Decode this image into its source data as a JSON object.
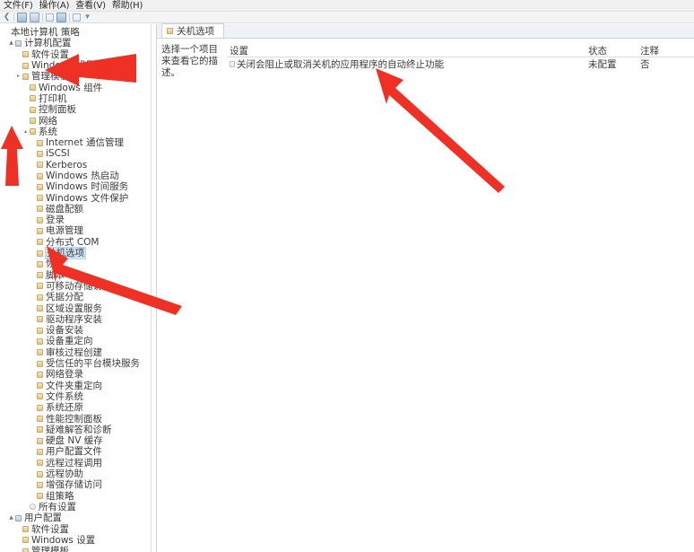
{
  "window": {
    "menu": [
      {
        "label": "文件(F)",
        "name": "menu-file"
      },
      {
        "label": "操作(A)",
        "name": "menu-action"
      },
      {
        "label": "查看(V)",
        "name": "menu-view"
      },
      {
        "label": "帮助(H)",
        "name": "menu-help"
      }
    ],
    "toolbar_icons": [
      "back-arrow-icon",
      "separator",
      "properties-icon",
      "folder-icon",
      "separator",
      "refresh-icon",
      "export-icon",
      "separator",
      "help-icon",
      "filter-icon"
    ]
  },
  "tree": {
    "root": "本地计算机 策略",
    "nodes": [
      {
        "label": "本地计算机 策略",
        "level": 0,
        "expander": "",
        "icon": "root",
        "selected": false
      },
      {
        "label": "计算机配置",
        "level": 1,
        "expander": "▲",
        "icon": "pc",
        "selected": false
      },
      {
        "label": "软件设置",
        "level": 2,
        "expander": "",
        "icon": "folder",
        "selected": false
      },
      {
        "label": "Windows 设置",
        "level": 2,
        "expander": "",
        "icon": "folder",
        "selected": false
      },
      {
        "label": "管理模板",
        "level": 2,
        "expander": "▸",
        "icon": "folder",
        "selected": false
      },
      {
        "label": "Windows 组件",
        "level": 3,
        "expander": "",
        "icon": "folder",
        "selected": false
      },
      {
        "label": "打印机",
        "level": 3,
        "expander": "",
        "icon": "folder",
        "selected": false
      },
      {
        "label": "控制面板",
        "level": 3,
        "expander": "",
        "icon": "folder",
        "selected": false
      },
      {
        "label": "网络",
        "level": 3,
        "expander": "",
        "icon": "folder",
        "selected": false
      },
      {
        "label": "系统",
        "level": 3,
        "expander": "▴",
        "icon": "folder",
        "selected": false
      },
      {
        "label": "Internet 通信管理",
        "level": 4,
        "expander": "",
        "icon": "folder",
        "selected": false
      },
      {
        "label": "iSCSI",
        "level": 4,
        "expander": "",
        "icon": "folder",
        "selected": false
      },
      {
        "label": "Kerberos",
        "level": 4,
        "expander": "",
        "icon": "folder",
        "selected": false
      },
      {
        "label": "Windows 热启动",
        "level": 4,
        "expander": "",
        "icon": "folder",
        "selected": false
      },
      {
        "label": "Windows 时间服务",
        "level": 4,
        "expander": "",
        "icon": "folder",
        "selected": false
      },
      {
        "label": "Windows 文件保护",
        "level": 4,
        "expander": "",
        "icon": "folder",
        "selected": false
      },
      {
        "label": "磁盘配额",
        "level": 4,
        "expander": "",
        "icon": "folder",
        "selected": false
      },
      {
        "label": "登录",
        "level": 4,
        "expander": "",
        "icon": "folder",
        "selected": false
      },
      {
        "label": "电源管理",
        "level": 4,
        "expander": "",
        "icon": "folder",
        "selected": false
      },
      {
        "label": "分布式 COM",
        "level": 4,
        "expander": "",
        "icon": "folder",
        "selected": false
      },
      {
        "label": "关机选项",
        "level": 4,
        "expander": "",
        "icon": "folder",
        "selected": true
      },
      {
        "label": "恢复",
        "level": 4,
        "expander": "",
        "icon": "folder",
        "selected": false
      },
      {
        "label": "脚本",
        "level": 4,
        "expander": "",
        "icon": "folder",
        "selected": false
      },
      {
        "label": "可移动存储访问",
        "level": 4,
        "expander": "",
        "icon": "folder",
        "selected": false
      },
      {
        "label": "凭据分配",
        "level": 4,
        "expander": "",
        "icon": "folder",
        "selected": false
      },
      {
        "label": "区域设置服务",
        "level": 4,
        "expander": "",
        "icon": "folder",
        "selected": false
      },
      {
        "label": "驱动程序安装",
        "level": 4,
        "expander": "",
        "icon": "folder",
        "selected": false
      },
      {
        "label": "设备安装",
        "level": 4,
        "expander": "",
        "icon": "folder",
        "selected": false
      },
      {
        "label": "设备重定向",
        "level": 4,
        "expander": "",
        "icon": "folder",
        "selected": false
      },
      {
        "label": "审核过程创建",
        "level": 4,
        "expander": "",
        "icon": "folder",
        "selected": false
      },
      {
        "label": "受信任的平台模块服务",
        "level": 4,
        "expander": "",
        "icon": "folder",
        "selected": false
      },
      {
        "label": "网络登录",
        "level": 4,
        "expander": "",
        "icon": "folder",
        "selected": false
      },
      {
        "label": "文件夹重定向",
        "level": 4,
        "expander": "",
        "icon": "folder",
        "selected": false
      },
      {
        "label": "文件系统",
        "level": 4,
        "expander": "",
        "icon": "folder",
        "selected": false
      },
      {
        "label": "系统还原",
        "level": 4,
        "expander": "",
        "icon": "folder",
        "selected": false
      },
      {
        "label": "性能控制面板",
        "level": 4,
        "expander": "",
        "icon": "folder",
        "selected": false
      },
      {
        "label": "疑难解答和诊断",
        "level": 4,
        "expander": "",
        "icon": "folder",
        "selected": false
      },
      {
        "label": "硬盘 NV 缓存",
        "level": 4,
        "expander": "",
        "icon": "folder",
        "selected": false
      },
      {
        "label": "用户配置文件",
        "level": 4,
        "expander": "",
        "icon": "folder",
        "selected": false
      },
      {
        "label": "远程过程调用",
        "level": 4,
        "expander": "",
        "icon": "folder",
        "selected": false
      },
      {
        "label": "远程协助",
        "level": 4,
        "expander": "",
        "icon": "folder",
        "selected": false
      },
      {
        "label": "增强存储访问",
        "level": 4,
        "expander": "",
        "icon": "folder",
        "selected": false
      },
      {
        "label": "组策略",
        "level": 4,
        "expander": "",
        "icon": "folder",
        "selected": false
      },
      {
        "label": "所有设置",
        "level": 3,
        "expander": "",
        "icon": "all",
        "selected": false
      },
      {
        "label": "用户配置",
        "level": 1,
        "expander": "▲",
        "icon": "pc",
        "selected": false
      },
      {
        "label": "软件设置",
        "level": 2,
        "expander": "",
        "icon": "folder",
        "selected": false
      },
      {
        "label": "Windows 设置",
        "level": 2,
        "expander": "",
        "icon": "folder",
        "selected": false
      },
      {
        "label": "管理模板",
        "level": 2,
        "expander": "",
        "icon": "folder",
        "selected": false
      }
    ]
  },
  "right_panel": {
    "tab_label": "关机选项",
    "description_prompt": "选择一个项目来查看它的描述。",
    "columns": {
      "setting": "设置",
      "state": "状态",
      "comment": "注释"
    },
    "rows": [
      {
        "setting": "关闭会阻止或取消关机的应用程序的自动终止功能",
        "state": "未配置",
        "comment": "否"
      }
    ]
  },
  "annotations": {
    "arrow_color": "#ee3124",
    "arrows": [
      {
        "name": "arrow-to-admin-templates"
      },
      {
        "name": "arrow-to-system-node"
      },
      {
        "name": "arrow-to-shutdown-options"
      },
      {
        "name": "arrow-to-policy-setting"
      }
    ]
  }
}
